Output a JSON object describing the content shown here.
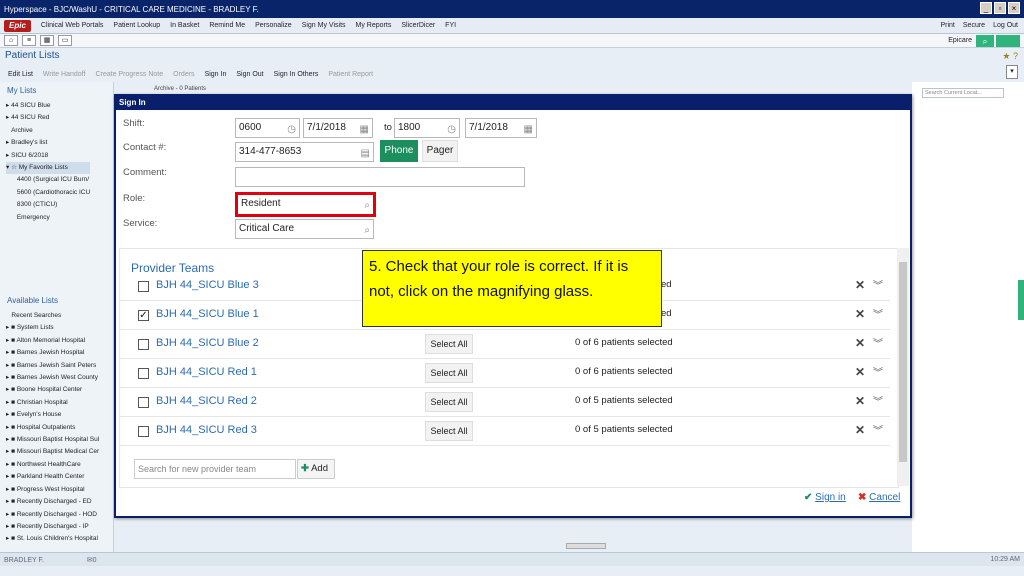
{
  "window": {
    "title": "Hyperspace - BJC/WashU - CRITICAL CARE MEDICINE - BRADLEY F."
  },
  "menubar": {
    "epic": "Epic",
    "items": [
      "Clinical Web Portals",
      "Patient Lookup",
      "In Basket",
      "Remind Me",
      "Personalize",
      "Sign My Visits",
      "My Reports",
      "SlicerDicer",
      "FYI"
    ],
    "right": [
      "Print",
      "Secure",
      "Log Out"
    ]
  },
  "toolbar2": {
    "epicare": "Epicare"
  },
  "page": {
    "title": "Patient Lists"
  },
  "actions": {
    "edit_list": "Edit List",
    "write_handoff": "Write Handoff",
    "create_progress_note": "Create Progress Note",
    "orders": "Orders",
    "sign_in": "Sign In",
    "sign_out": "Sign Out",
    "sign_in_others": "Sign In Others",
    "patient_report": "Patient Report"
  },
  "archive_header": "Archive - 0 Patients",
  "my_lists": {
    "header": "My Lists",
    "items": [
      "44 SICU Blue",
      "44 SICU Red",
      "Archive",
      "Bradley's list",
      "SICU 6/2018",
      "My Favorite Lists",
      "4400 (Surgical ICU Burn/",
      "5600 (Cardiothoracic ICU",
      "8300 (CTICU)",
      "Emergency"
    ]
  },
  "available_lists": {
    "header": "Available Lists",
    "items": [
      "Recent Searches",
      "System Lists",
      "Alton Memorial Hospital",
      "Barnes Jewish Hospital",
      "Barnes Jewish Saint Peters",
      "Barnes Jewish West County",
      "Boone Hospital Center",
      "Christian Hospital",
      "Evelyn's House",
      "Hospital Outpatients",
      "Missouri Baptist Hospital Sul",
      "Missouri Baptist Medical Cer",
      "Northwest HealthCare",
      "Parkland Health Center",
      "Progress West Hospital",
      "Recently Discharged - ED",
      "Recently Discharged - HOD",
      "Recently Discharged - IP",
      "St. Louis Children's Hospital"
    ]
  },
  "right_search": {
    "placeholder": "Search Current Locat..."
  },
  "status": {
    "user": "BRADLEY F.",
    "messages": "0",
    "time": "10:29 AM"
  },
  "dialog": {
    "title": "Sign In",
    "shift_label": "Shift:",
    "shift_start_time": "0600",
    "shift_start_date": "7/1/2018",
    "to_label": "to",
    "shift_end_time": "1800",
    "shift_end_date": "7/1/2018",
    "contact_label": "Contact #:",
    "contact_value": "314-477-8653",
    "phone_btn": "Phone",
    "pager_btn": "Pager",
    "comment_label": "Comment:",
    "comment_value": "",
    "role_label": "Role:",
    "role_value": "Resident",
    "service_label": "Service:",
    "service_value": "Critical Care",
    "provider_teams_header": "Provider Teams",
    "teams": [
      {
        "name": "BJH 44_SICU Blue 3",
        "checked": false,
        "select_all": "",
        "count": "ed"
      },
      {
        "name": "BJH 44_SICU Blue 1",
        "checked": true,
        "select_all": "",
        "count": "ed"
      },
      {
        "name": "BJH 44_SICU Blue 2",
        "checked": false,
        "select_all": "Select All",
        "count": "0 of 6 patients selected"
      },
      {
        "name": "BJH 44_SICU Red 1",
        "checked": false,
        "select_all": "Select All",
        "count": "0 of 6 patients selected"
      },
      {
        "name": "BJH 44_SICU Red 2",
        "checked": false,
        "select_all": "Select All",
        "count": "0 of 5 patients selected"
      },
      {
        "name": "BJH 44_SICU Red 3",
        "checked": false,
        "select_all": "Select All",
        "count": "0 of 5 patients selected"
      }
    ],
    "team_search_placeholder": "Search for new provider team",
    "add_btn": "Add",
    "sign_in_btn": "Sign in",
    "cancel_btn": "Cancel"
  },
  "callout": "5. Check that your role is correct.  If it is not, click on the magnifying glass."
}
